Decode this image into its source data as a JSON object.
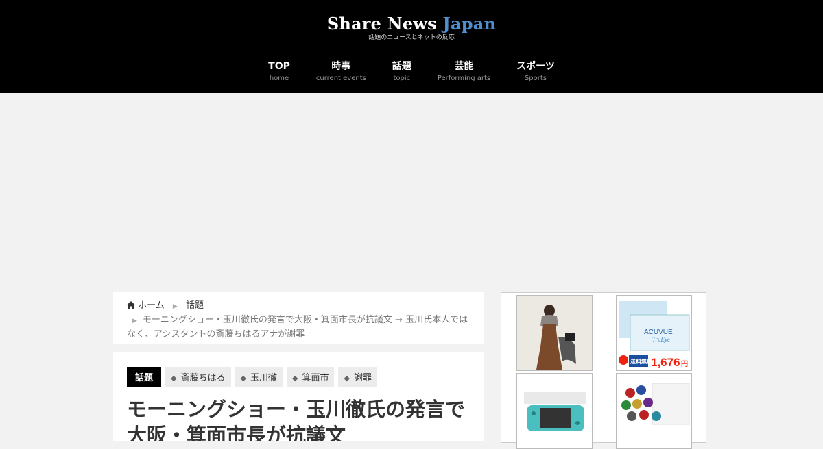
{
  "site": {
    "logo_main": "Share News",
    "logo_accent": "Japan",
    "logo_sub": "話題のニュースとネットの反応"
  },
  "nav": [
    {
      "label": "TOP",
      "sub": "home"
    },
    {
      "label": "時事",
      "sub": "current events"
    },
    {
      "label": "話題",
      "sub": "topic"
    },
    {
      "label": "芸能",
      "sub": "Performing arts"
    },
    {
      "label": "スポーツ",
      "sub": "Sports"
    }
  ],
  "breadcrumb": {
    "home": "ホーム",
    "category": "話題",
    "current": "モーニングショー・玉川徹氏の発言で大阪・箕面市長が抗議文 → 玉川氏本人ではなく、アシスタントの斎藤ちはるアナが謝罪"
  },
  "article": {
    "category": "話題",
    "tags": [
      "斎藤ちはる",
      "玉川徹",
      "箕面市",
      "謝罪"
    ],
    "title": "モーニングショー・玉川徹氏の発言で大阪・箕面市長が抗議文"
  },
  "sidebar": {
    "ad_price": "1,676",
    "ad_price_unit": "円",
    "ad_free_ship": "送料無料",
    "ad_brand": "ACUVUE",
    "ad_brand_sub": "TruEye"
  },
  "colors": {
    "accent": "#4f8fce",
    "header_bg": "#000000",
    "page_bg": "#f2f2f2"
  }
}
